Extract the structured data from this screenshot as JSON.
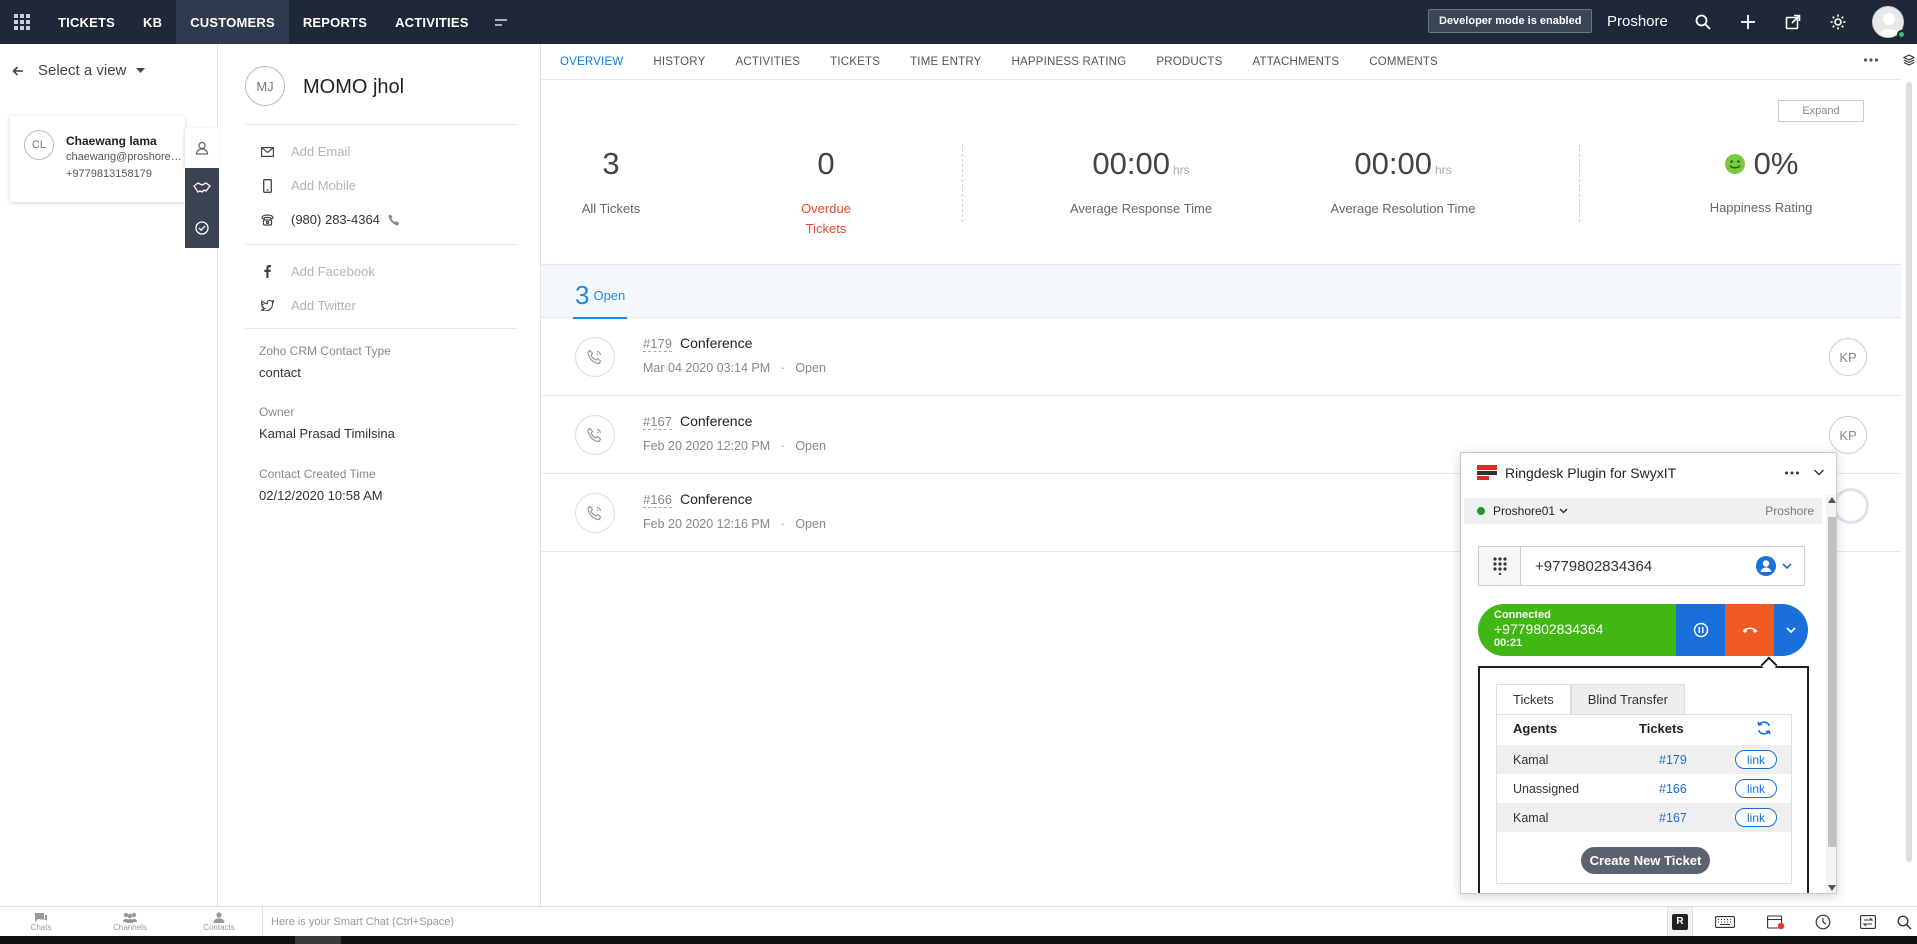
{
  "topbar": {
    "nav": [
      "TICKETS",
      "KB",
      "CUSTOMERS",
      "REPORTS",
      "ACTIVITIES"
    ],
    "active_nav": "CUSTOMERS",
    "dev_badge": "Developer mode is enabled",
    "org_name": "Proshore",
    "icons": [
      "apps-grid-icon",
      "more-modules-icon",
      "search-icon",
      "add-icon",
      "open-external-icon",
      "settings-icon",
      "user-avatar"
    ]
  },
  "left": {
    "view_select": "Select a view",
    "contact": {
      "initials": "CL",
      "name": "Chaewang lama",
      "email": "chaewang@proshore.eu",
      "phone": "+9779813158179"
    }
  },
  "details": {
    "initials": "MJ",
    "name": "MOMO jhol",
    "add_email": "Add Email",
    "add_mobile": "Add Mobile",
    "phone": "(980) 283-4364",
    "add_facebook": "Add Facebook",
    "add_twitter": "Add Twitter",
    "fields": [
      {
        "label": "Zoho CRM Contact Type",
        "value": "contact"
      },
      {
        "label": "Owner",
        "value": "Kamal Prasad Timilsina"
      },
      {
        "label": "Contact Created Time",
        "value": "02/12/2020 10:58 AM"
      }
    ]
  },
  "tabs": [
    "OVERVIEW",
    "HISTORY",
    "ACTIVITIES",
    "TICKETS",
    "TIME ENTRY",
    "HAPPINESS RATING",
    "PRODUCTS",
    "ATTACHMENTS",
    "COMMENTS"
  ],
  "active_tab": "OVERVIEW",
  "expand_label": "Expand",
  "stats": {
    "all_tickets": {
      "value": "3",
      "label": "All Tickets"
    },
    "overdue": {
      "value": "0",
      "label_1": "Overdue",
      "label_2": "Tickets"
    },
    "avg_response": {
      "value": "00:00",
      "unit": "hrs",
      "label": "Average Response Time"
    },
    "avg_resolution": {
      "value": "00:00",
      "unit": "hrs",
      "label": "Average Resolution Time"
    },
    "happiness": {
      "value": "0%",
      "label": "Happiness Rating"
    }
  },
  "open": {
    "count": "3",
    "label": "Open"
  },
  "tickets": [
    {
      "id": "#179",
      "subject": "Conference",
      "date": "Mar 04 2020 03:14 PM",
      "status": "Open",
      "assignee": "KP"
    },
    {
      "id": "#167",
      "subject": "Conference",
      "date": "Feb 20 2020 12:20 PM",
      "status": "Open",
      "assignee": "KP"
    },
    {
      "id": "#166",
      "subject": "Conference",
      "date": "Feb 20 2020 12:16 PM",
      "status": "Open",
      "assignee": ""
    }
  ],
  "ringdesk": {
    "title": "Ringdesk Plugin for SwyxIT",
    "user": "Proshore01",
    "org": "Proshore",
    "dial_number": "+9779802834364",
    "call": {
      "status": "Connected",
      "number": "+9779802834364",
      "duration": "00:21"
    },
    "panel_tabs": [
      "Tickets",
      "Blind Transfer"
    ],
    "table_headers": {
      "agents": "Agents",
      "tickets": "Tickets"
    },
    "rows": [
      {
        "agent": "Kamal",
        "ticket": "#179",
        "link": "link"
      },
      {
        "agent": "Unassigned",
        "ticket": "#166",
        "link": "link"
      },
      {
        "agent": "Kamal",
        "ticket": "#167",
        "link": "link"
      }
    ],
    "create_label": "Create New Ticket",
    "colors": {
      "connected": "#41b713",
      "hold": "#1b6fdb",
      "hangup": "#f15a22"
    }
  },
  "bottombar": {
    "items": [
      "Chats",
      "Channels",
      "Contacts"
    ],
    "smartchat_placeholder": "Here is your Smart Chat (Ctrl+Space)",
    "r_badge": "R"
  }
}
